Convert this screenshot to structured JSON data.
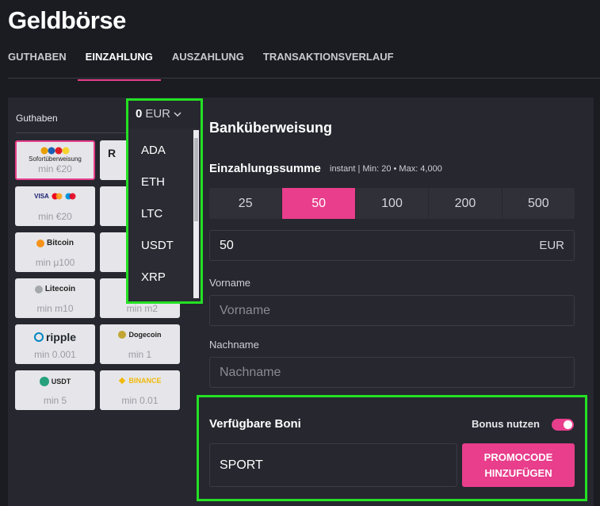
{
  "page": {
    "title": "Geldbörse"
  },
  "tabs": [
    {
      "label": "GUTHABEN"
    },
    {
      "label": "EINZAHLUNG",
      "active": true
    },
    {
      "label": "AUSZAHLUNG"
    },
    {
      "label": "TRANSAKTIONSVERLAUF"
    }
  ],
  "left": {
    "label": "Guthaben",
    "methods": [
      {
        "name": "Sofortüberweisung",
        "min": "min €20",
        "selected": true
      },
      {
        "name": "Visa / Mastercard / Maestro",
        "logo": "VISA",
        "min": "min €20"
      },
      {
        "name": "Bitcoin",
        "min": "min μ100"
      },
      {
        "name": "Litecoin",
        "min": "min m10"
      },
      {
        "name": "ripple",
        "min": "min 0.001"
      },
      {
        "name": "Dogecoin",
        "min": "min 1"
      },
      {
        "name": "USDT",
        "min": "min 5"
      },
      {
        "name": "BINANCE",
        "min": "min 0.01"
      },
      {
        "name": "",
        "min": "min m2"
      }
    ]
  },
  "currency": {
    "amount": "0",
    "code": "EUR",
    "options": [
      "ADA",
      "ETH",
      "LTC",
      "USDT",
      "XRP"
    ]
  },
  "deposit": {
    "heading": "Banküberweisung",
    "sum_label": "Einzahlungssumme",
    "sum_info": "instant | Min: 20 • Max: 4,000",
    "amounts": [
      "25",
      "50",
      "100",
      "200",
      "500"
    ],
    "active_amount": "50",
    "amount_value": "50",
    "amount_currency": "EUR",
    "firstname_label": "Vorname",
    "firstname_placeholder": "Vorname",
    "lastname_label": "Nachname",
    "lastname_placeholder": "Nachname"
  },
  "bonus": {
    "title": "Verfügbare Boni",
    "use_label": "Bonus nutzen",
    "enabled": true,
    "promo_value": "SPORT",
    "promo_button_line1": "PROMOCODE",
    "promo_button_line2": "HINZUFÜGEN"
  },
  "colors": {
    "accent": "#e83e8c",
    "highlight": "#24e024",
    "background": "#1b1c22",
    "panel": "#26272f"
  }
}
